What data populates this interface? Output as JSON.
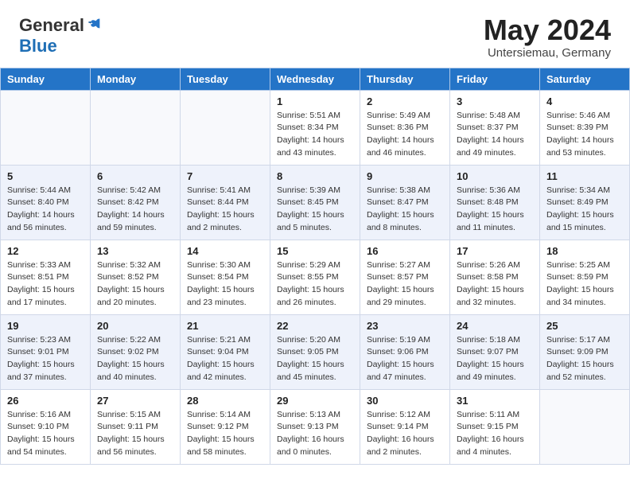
{
  "header": {
    "logo_general": "General",
    "logo_blue": "Blue",
    "month_title": "May 2024",
    "location": "Untersiemau, Germany"
  },
  "days_of_week": [
    "Sunday",
    "Monday",
    "Tuesday",
    "Wednesday",
    "Thursday",
    "Friday",
    "Saturday"
  ],
  "weeks": [
    [
      {
        "day": "",
        "info": ""
      },
      {
        "day": "",
        "info": ""
      },
      {
        "day": "",
        "info": ""
      },
      {
        "day": "1",
        "info": "Sunrise: 5:51 AM\nSunset: 8:34 PM\nDaylight: 14 hours\nand 43 minutes."
      },
      {
        "day": "2",
        "info": "Sunrise: 5:49 AM\nSunset: 8:36 PM\nDaylight: 14 hours\nand 46 minutes."
      },
      {
        "day": "3",
        "info": "Sunrise: 5:48 AM\nSunset: 8:37 PM\nDaylight: 14 hours\nand 49 minutes."
      },
      {
        "day": "4",
        "info": "Sunrise: 5:46 AM\nSunset: 8:39 PM\nDaylight: 14 hours\nand 53 minutes."
      }
    ],
    [
      {
        "day": "5",
        "info": "Sunrise: 5:44 AM\nSunset: 8:40 PM\nDaylight: 14 hours\nand 56 minutes."
      },
      {
        "day": "6",
        "info": "Sunrise: 5:42 AM\nSunset: 8:42 PM\nDaylight: 14 hours\nand 59 minutes."
      },
      {
        "day": "7",
        "info": "Sunrise: 5:41 AM\nSunset: 8:44 PM\nDaylight: 15 hours\nand 2 minutes."
      },
      {
        "day": "8",
        "info": "Sunrise: 5:39 AM\nSunset: 8:45 PM\nDaylight: 15 hours\nand 5 minutes."
      },
      {
        "day": "9",
        "info": "Sunrise: 5:38 AM\nSunset: 8:47 PM\nDaylight: 15 hours\nand 8 minutes."
      },
      {
        "day": "10",
        "info": "Sunrise: 5:36 AM\nSunset: 8:48 PM\nDaylight: 15 hours\nand 11 minutes."
      },
      {
        "day": "11",
        "info": "Sunrise: 5:34 AM\nSunset: 8:49 PM\nDaylight: 15 hours\nand 15 minutes."
      }
    ],
    [
      {
        "day": "12",
        "info": "Sunrise: 5:33 AM\nSunset: 8:51 PM\nDaylight: 15 hours\nand 17 minutes."
      },
      {
        "day": "13",
        "info": "Sunrise: 5:32 AM\nSunset: 8:52 PM\nDaylight: 15 hours\nand 20 minutes."
      },
      {
        "day": "14",
        "info": "Sunrise: 5:30 AM\nSunset: 8:54 PM\nDaylight: 15 hours\nand 23 minutes."
      },
      {
        "day": "15",
        "info": "Sunrise: 5:29 AM\nSunset: 8:55 PM\nDaylight: 15 hours\nand 26 minutes."
      },
      {
        "day": "16",
        "info": "Sunrise: 5:27 AM\nSunset: 8:57 PM\nDaylight: 15 hours\nand 29 minutes."
      },
      {
        "day": "17",
        "info": "Sunrise: 5:26 AM\nSunset: 8:58 PM\nDaylight: 15 hours\nand 32 minutes."
      },
      {
        "day": "18",
        "info": "Sunrise: 5:25 AM\nSunset: 8:59 PM\nDaylight: 15 hours\nand 34 minutes."
      }
    ],
    [
      {
        "day": "19",
        "info": "Sunrise: 5:23 AM\nSunset: 9:01 PM\nDaylight: 15 hours\nand 37 minutes."
      },
      {
        "day": "20",
        "info": "Sunrise: 5:22 AM\nSunset: 9:02 PM\nDaylight: 15 hours\nand 40 minutes."
      },
      {
        "day": "21",
        "info": "Sunrise: 5:21 AM\nSunset: 9:04 PM\nDaylight: 15 hours\nand 42 minutes."
      },
      {
        "day": "22",
        "info": "Sunrise: 5:20 AM\nSunset: 9:05 PM\nDaylight: 15 hours\nand 45 minutes."
      },
      {
        "day": "23",
        "info": "Sunrise: 5:19 AM\nSunset: 9:06 PM\nDaylight: 15 hours\nand 47 minutes."
      },
      {
        "day": "24",
        "info": "Sunrise: 5:18 AM\nSunset: 9:07 PM\nDaylight: 15 hours\nand 49 minutes."
      },
      {
        "day": "25",
        "info": "Sunrise: 5:17 AM\nSunset: 9:09 PM\nDaylight: 15 hours\nand 52 minutes."
      }
    ],
    [
      {
        "day": "26",
        "info": "Sunrise: 5:16 AM\nSunset: 9:10 PM\nDaylight: 15 hours\nand 54 minutes."
      },
      {
        "day": "27",
        "info": "Sunrise: 5:15 AM\nSunset: 9:11 PM\nDaylight: 15 hours\nand 56 minutes."
      },
      {
        "day": "28",
        "info": "Sunrise: 5:14 AM\nSunset: 9:12 PM\nDaylight: 15 hours\nand 58 minutes."
      },
      {
        "day": "29",
        "info": "Sunrise: 5:13 AM\nSunset: 9:13 PM\nDaylight: 16 hours\nand 0 minutes."
      },
      {
        "day": "30",
        "info": "Sunrise: 5:12 AM\nSunset: 9:14 PM\nDaylight: 16 hours\nand 2 minutes."
      },
      {
        "day": "31",
        "info": "Sunrise: 5:11 AM\nSunset: 9:15 PM\nDaylight: 16 hours\nand 4 minutes."
      },
      {
        "day": "",
        "info": ""
      }
    ]
  ]
}
